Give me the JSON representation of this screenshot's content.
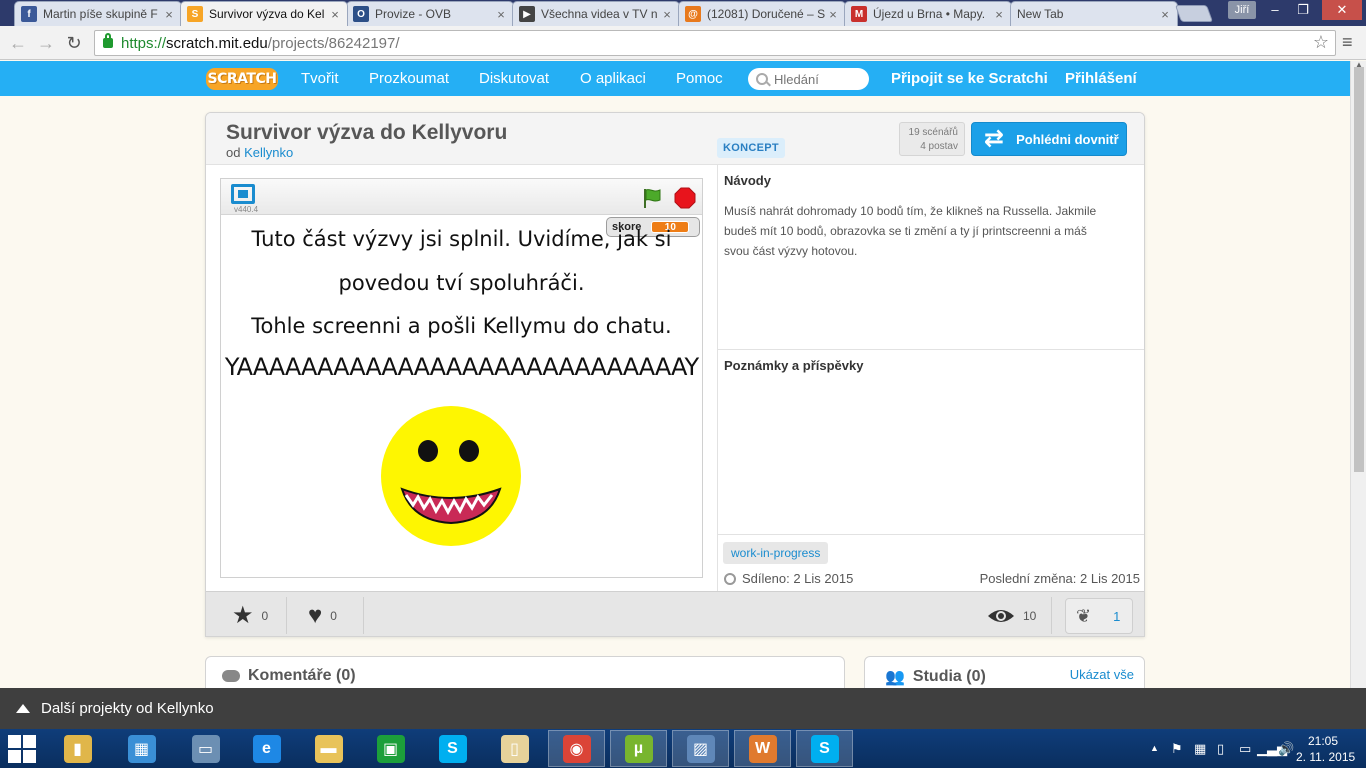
{
  "browser": {
    "tabs": [
      {
        "title": "Martin píše skupině F",
        "icon": "facebook-icon",
        "icon_color": "#3b5998",
        "icon_glyph": "f"
      },
      {
        "title": "Survivor výzva do Kel",
        "icon": "scratch-icon",
        "icon_color": "#f7a526",
        "icon_glyph": "S"
      },
      {
        "title": "Provize - OVB",
        "icon": "ovb-icon",
        "icon_color": "#2c4f87",
        "icon_glyph": "O"
      },
      {
        "title": "Všechna videa v TV n",
        "icon": "video-icon",
        "icon_color": "#444444",
        "icon_glyph": "▶"
      },
      {
        "title": "(12081) Doručené – S",
        "icon": "mail-icon",
        "icon_color": "#e8791c",
        "icon_glyph": "@"
      },
      {
        "title": "Újezd u Brna • Mapy.",
        "icon": "map-icon",
        "icon_color": "#c9302c",
        "icon_glyph": "M"
      },
      {
        "title": "New Tab",
        "icon": "",
        "icon_color": "",
        "icon_glyph": ""
      }
    ],
    "user_name": "Jiří",
    "url_scheme": "https://",
    "url_host": "scratch.mit.edu",
    "url_path": "/projects/86242197/"
  },
  "header": {
    "logo": "SCRATCH",
    "nav": [
      "Tvořit",
      "Prozkoumat",
      "Diskutovat",
      "O aplikaci",
      "Pomoc"
    ],
    "search_placeholder": "Hledání",
    "join": "Připojit se ke Scratchi",
    "login": "Přihlášení"
  },
  "project": {
    "title": "Survivor výzva do Kellyvoru",
    "by_prefix": "od",
    "author": "Kellynko",
    "concept_badge": "KONCEPT",
    "scripts_count": "19 scénářů",
    "sprites_count": "4 postav",
    "see_inside": "Pohlédni dovnitř",
    "version": "v440.4",
    "score_label": "skore",
    "score_value": "10",
    "stage_lines": [
      "Tuto část výzvy jsi splnil. Uvidíme, jak si",
      "povedou tví spoluhráči.",
      "Tohle screenni a pošli Kellymu do chatu.",
      "YAAAAAAAAAAAAAAAAAAAAAAAAAAAAY"
    ],
    "instructions_heading": "Návody",
    "instructions_text": "Musíš nahrát dohromady 10 bodů tím, že klikneš na Russella. Jakmile budeš mít 10 bodů, obrazovka se ti změní a ty jí printscreenni a máš svou část výzvy hotovou.",
    "notes_heading": "Poznámky a příspěvky",
    "tag": "work-in-progress",
    "shared": "Sdíleno: 2 Lis 2015",
    "modified": "Poslední změna: 2 Lis 2015",
    "favorites": "0",
    "loves": "0",
    "views": "10",
    "remixes": "1"
  },
  "comments": {
    "heading": "Komentáře (0)"
  },
  "studios": {
    "heading": "Studia (0)",
    "view_all": "Ukázat vše"
  },
  "footer_bar": {
    "label": "Další projekty od Kellynko"
  },
  "taskbar": {
    "apps": [
      {
        "name": "file-explorer-icon",
        "color": "#e0b64a",
        "glyph": "▮"
      },
      {
        "name": "control-panel-icon",
        "color": "#3a8fd6",
        "glyph": "▦"
      },
      {
        "name": "computer-icon",
        "color": "#6c8fb3",
        "glyph": "▭"
      },
      {
        "name": "internet-explorer-icon",
        "color": "#1e88e5",
        "glyph": "e"
      },
      {
        "name": "folder-icon",
        "color": "#e8c35a",
        "glyph": "▬"
      },
      {
        "name": "store-icon",
        "color": "#1c9f3a",
        "glyph": "▣"
      },
      {
        "name": "skype-icon",
        "color": "#00aff0",
        "glyph": "S"
      },
      {
        "name": "documents-icon",
        "color": "#e6d29a",
        "glyph": "▯"
      },
      {
        "name": "chrome-icon",
        "color": "#db4437",
        "glyph": "◉"
      },
      {
        "name": "utorrent-icon",
        "color": "#78b52e",
        "glyph": "µ"
      },
      {
        "name": "photos-icon",
        "color": "#5f87b8",
        "glyph": "▨"
      },
      {
        "name": "word-icon",
        "color": "#e07a2e",
        "glyph": "W"
      },
      {
        "name": "skype-active-icon",
        "color": "#00aff0",
        "glyph": "S"
      }
    ],
    "time": "21:05",
    "date": "2. 11. 2015"
  }
}
